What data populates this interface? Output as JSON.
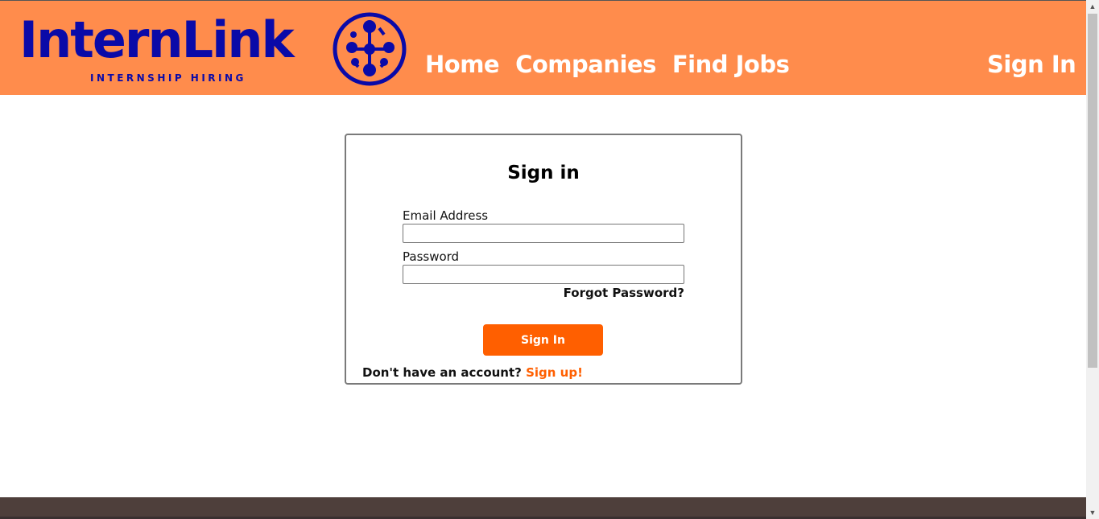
{
  "header": {
    "logo_text": "InternLink",
    "logo_tagline": "INTERNSHIP HIRING",
    "nav": [
      "Home",
      "Companies",
      "Find Jobs"
    ],
    "sign_in": "Sign In"
  },
  "card": {
    "title": "Sign in",
    "email_label": "Email Address",
    "email_value": "",
    "password_label": "Password",
    "password_value": "",
    "forgot": "Forgot Password?",
    "button": "Sign In",
    "signup_prompt": "Don't have an account?",
    "signup_link": "Sign up!"
  },
  "colors": {
    "header_bg": "#ff8c4c",
    "brand": "#0a0aa8",
    "accent": "#ff5f00",
    "footer_bg": "#4e3f3b"
  },
  "icons": {
    "logo": "network-nodes-icon",
    "scroll_up": "scroll-up-arrow-icon",
    "scroll_down": "scroll-down-arrow-icon"
  }
}
